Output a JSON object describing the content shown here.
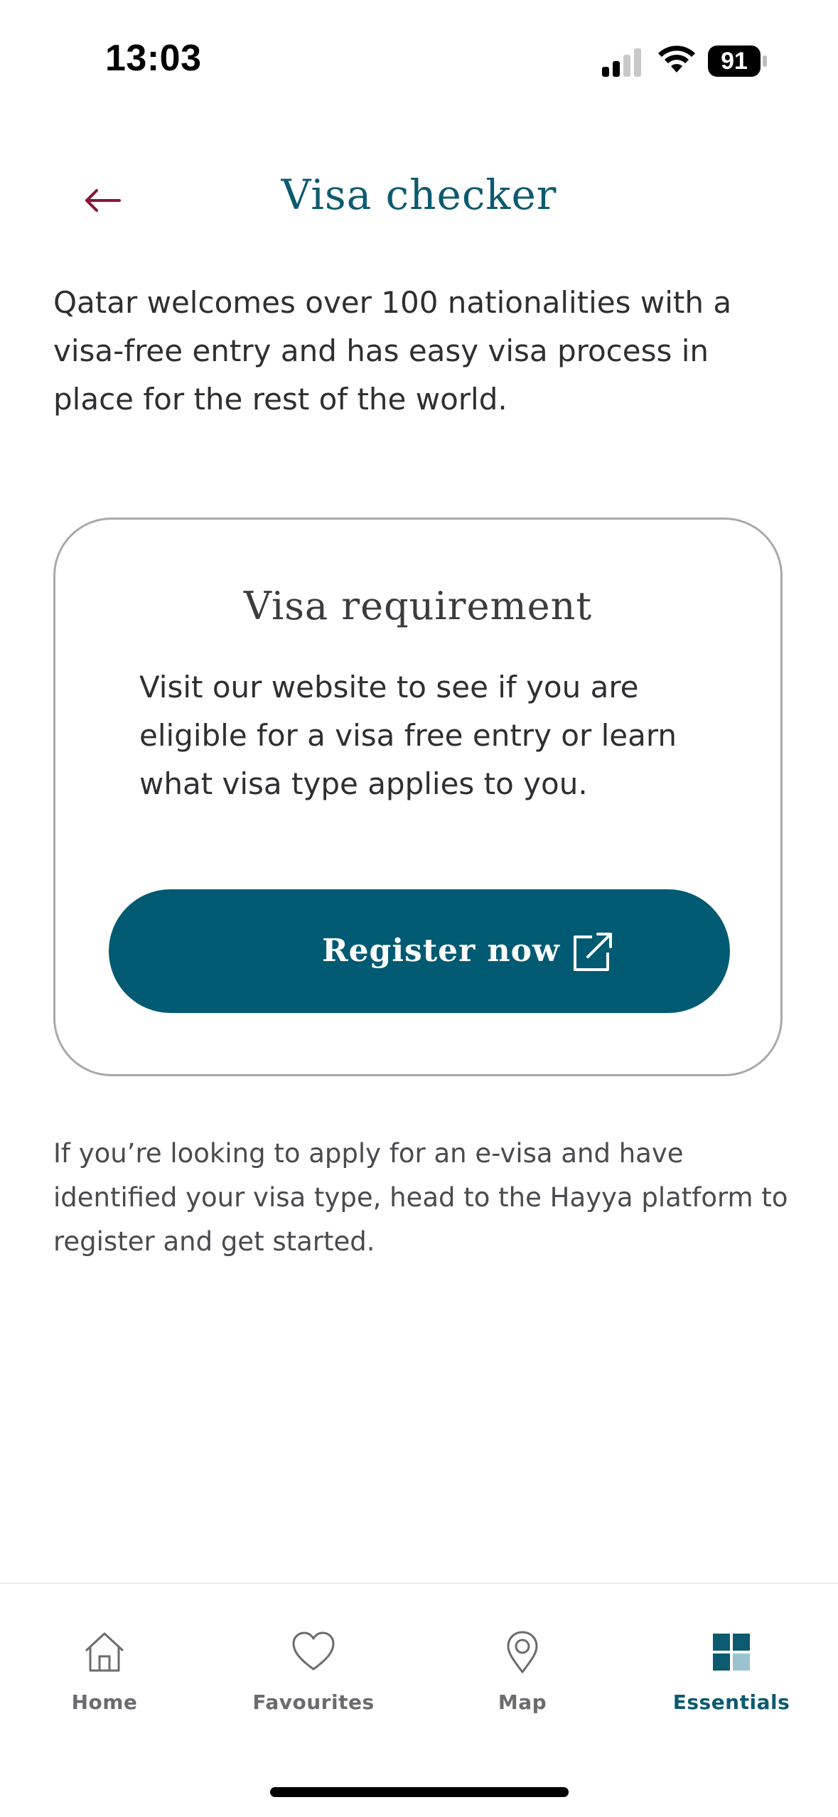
{
  "status_bar": {
    "time": "13:03",
    "battery": "91",
    "icons": [
      "cellular-signal-icon",
      "wifi-icon",
      "battery-icon"
    ]
  },
  "header": {
    "title": "Visa checker",
    "back_icon": "arrow-left-icon"
  },
  "intro": "Qatar welcomes over 100 nationalities with a visa-free entry and has easy visa process in place for the rest of the world.",
  "card": {
    "title": "Visa requirement",
    "body": "Visit our website to see if you are eligible for a visa free entry or learn what visa type applies to you.",
    "button_label": "Register now",
    "button_icon": "external-link-icon"
  },
  "footer_text": "If you’re looking to apply for an e-visa and have identified your visa type, head to the Hayya platform to register and get started.",
  "tabs": [
    {
      "label": "Home",
      "icon": "home-icon",
      "active": false
    },
    {
      "label": "Favourites",
      "icon": "heart-icon",
      "active": false
    },
    {
      "label": "Map",
      "icon": "map-pin-icon",
      "active": false
    },
    {
      "label": "Essentials",
      "icon": "grid-icon",
      "active": true
    }
  ],
  "colors": {
    "accent": "#005a72",
    "title": "#0d5a70",
    "back_arrow": "#8a1538",
    "card_border": "#a9a9a9"
  }
}
